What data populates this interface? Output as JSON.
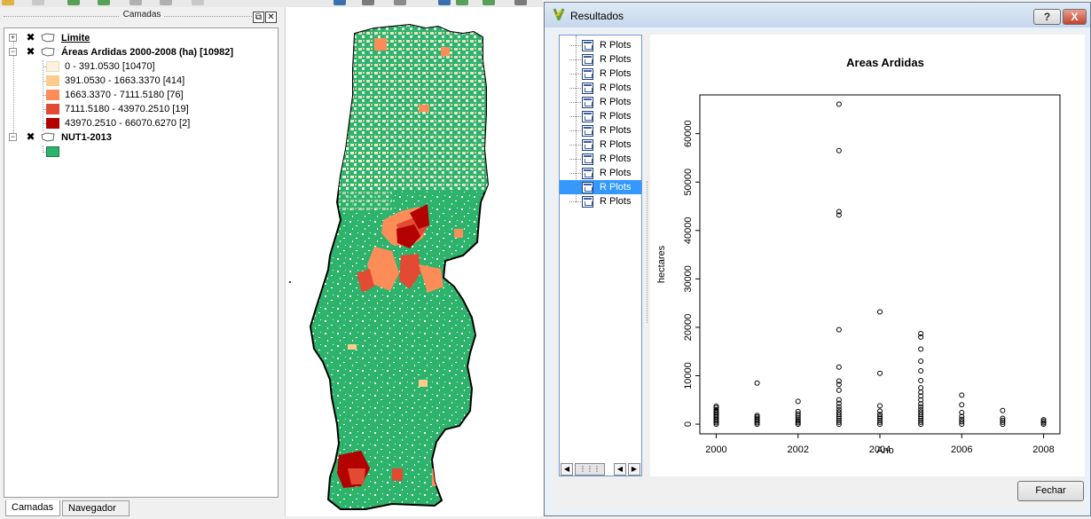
{
  "layers_panel": {
    "title": "Camadas",
    "layers": [
      {
        "name": "Limite"
      },
      {
        "name": "Áreas Ardidas 2000-2008 (ha) [10982]",
        "classes": [
          {
            "label": "0 - 391.0530 [10470]",
            "color": "#fdf0dc"
          },
          {
            "label": "391.0530 - 1663.3370 [414]",
            "color": "#fdcc8a"
          },
          {
            "label": "1663.3370 - 7111.5180 [76]",
            "color": "#fc8d59"
          },
          {
            "label": "7111.5180 - 43970.2510 [19]",
            "color": "#e34a33"
          },
          {
            "label": "43970.2510 - 66070.6270 [2]",
            "color": "#b30000"
          }
        ]
      },
      {
        "name": "NUT1-2013",
        "color": "#2db36b"
      }
    ],
    "tabs": [
      "Camadas",
      "Navegador"
    ]
  },
  "results_window": {
    "title": "Resultados",
    "help_label": "?",
    "close_label": "X",
    "list_items": [
      "R Plots",
      "R Plots",
      "R Plots",
      "R Plots",
      "R Plots",
      "R Plots",
      "R Plots",
      "R Plots",
      "R Plots",
      "R Plots",
      "R Plots",
      "R Plots"
    ],
    "selected_index": 10,
    "close_button_label": "Fechar"
  },
  "colors": {
    "map_green": "#2db36b",
    "selection": "#3399ff"
  },
  "chart_data": {
    "type": "scatter",
    "title": "Areas Ardidas",
    "xlabel": "Ano",
    "ylabel": "hectares",
    "xlim": [
      1999.6,
      2008.4
    ],
    "ylim": [
      -2000,
      68000
    ],
    "xticks": [
      2000,
      2002,
      2004,
      2006,
      2008
    ],
    "yticks": [
      0,
      10000,
      20000,
      30000,
      40000,
      50000,
      60000
    ],
    "series": [
      {
        "points": [
          [
            2000,
            0
          ],
          [
            2000,
            300
          ],
          [
            2000,
            600
          ],
          [
            2000,
            900
          ],
          [
            2000,
            1200
          ],
          [
            2000,
            1500
          ],
          [
            2000,
            1800
          ],
          [
            2000,
            2100
          ],
          [
            2000,
            2400
          ],
          [
            2000,
            2700
          ],
          [
            2000,
            3000
          ],
          [
            2000,
            3400
          ],
          [
            2000,
            3700
          ],
          [
            2001,
            0
          ],
          [
            2001,
            300
          ],
          [
            2001,
            600
          ],
          [
            2001,
            900
          ],
          [
            2001,
            1200
          ],
          [
            2001,
            1500
          ],
          [
            2001,
            1800
          ],
          [
            2001,
            8500
          ],
          [
            2002,
            0
          ],
          [
            2002,
            300
          ],
          [
            2002,
            600
          ],
          [
            2002,
            900
          ],
          [
            2002,
            1300
          ],
          [
            2002,
            1700
          ],
          [
            2002,
            2100
          ],
          [
            2002,
            2600
          ],
          [
            2002,
            4700
          ],
          [
            2003,
            0
          ],
          [
            2003,
            400
          ],
          [
            2003,
            800
          ],
          [
            2003,
            1200
          ],
          [
            2003,
            1600
          ],
          [
            2003,
            2000
          ],
          [
            2003,
            2500
          ],
          [
            2003,
            3000
          ],
          [
            2003,
            3600
          ],
          [
            2003,
            4300
          ],
          [
            2003,
            5000
          ],
          [
            2003,
            7000
          ],
          [
            2003,
            8200
          ],
          [
            2003,
            8900
          ],
          [
            2003,
            11800
          ],
          [
            2003,
            19500
          ],
          [
            2003,
            43200
          ],
          [
            2003,
            43900
          ],
          [
            2003,
            56500
          ],
          [
            2003,
            66100
          ],
          [
            2004,
            0
          ],
          [
            2004,
            400
          ],
          [
            2004,
            800
          ],
          [
            2004,
            1200
          ],
          [
            2004,
            1600
          ],
          [
            2004,
            2000
          ],
          [
            2004,
            2700
          ],
          [
            2004,
            3800
          ],
          [
            2004,
            10500
          ],
          [
            2004,
            23200
          ],
          [
            2005,
            0
          ],
          [
            2005,
            400
          ],
          [
            2005,
            800
          ],
          [
            2005,
            1200
          ],
          [
            2005,
            1600
          ],
          [
            2005,
            2000
          ],
          [
            2005,
            2500
          ],
          [
            2005,
            3000
          ],
          [
            2005,
            3600
          ],
          [
            2005,
            4200
          ],
          [
            2005,
            5000
          ],
          [
            2005,
            5800
          ],
          [
            2005,
            6600
          ],
          [
            2005,
            7500
          ],
          [
            2005,
            9000
          ],
          [
            2005,
            11000
          ],
          [
            2005,
            13000
          ],
          [
            2005,
            15500
          ],
          [
            2005,
            18000
          ],
          [
            2005,
            18700
          ],
          [
            2006,
            0
          ],
          [
            2006,
            500
          ],
          [
            2006,
            1000
          ],
          [
            2006,
            1600
          ],
          [
            2006,
            2400
          ],
          [
            2006,
            4000
          ],
          [
            2006,
            6000
          ],
          [
            2007,
            0
          ],
          [
            2007,
            400
          ],
          [
            2007,
            800
          ],
          [
            2007,
            1200
          ],
          [
            2007,
            2800
          ],
          [
            2008,
            0
          ],
          [
            2008,
            300
          ],
          [
            2008,
            600
          ],
          [
            2008,
            900
          ]
        ]
      }
    ]
  }
}
